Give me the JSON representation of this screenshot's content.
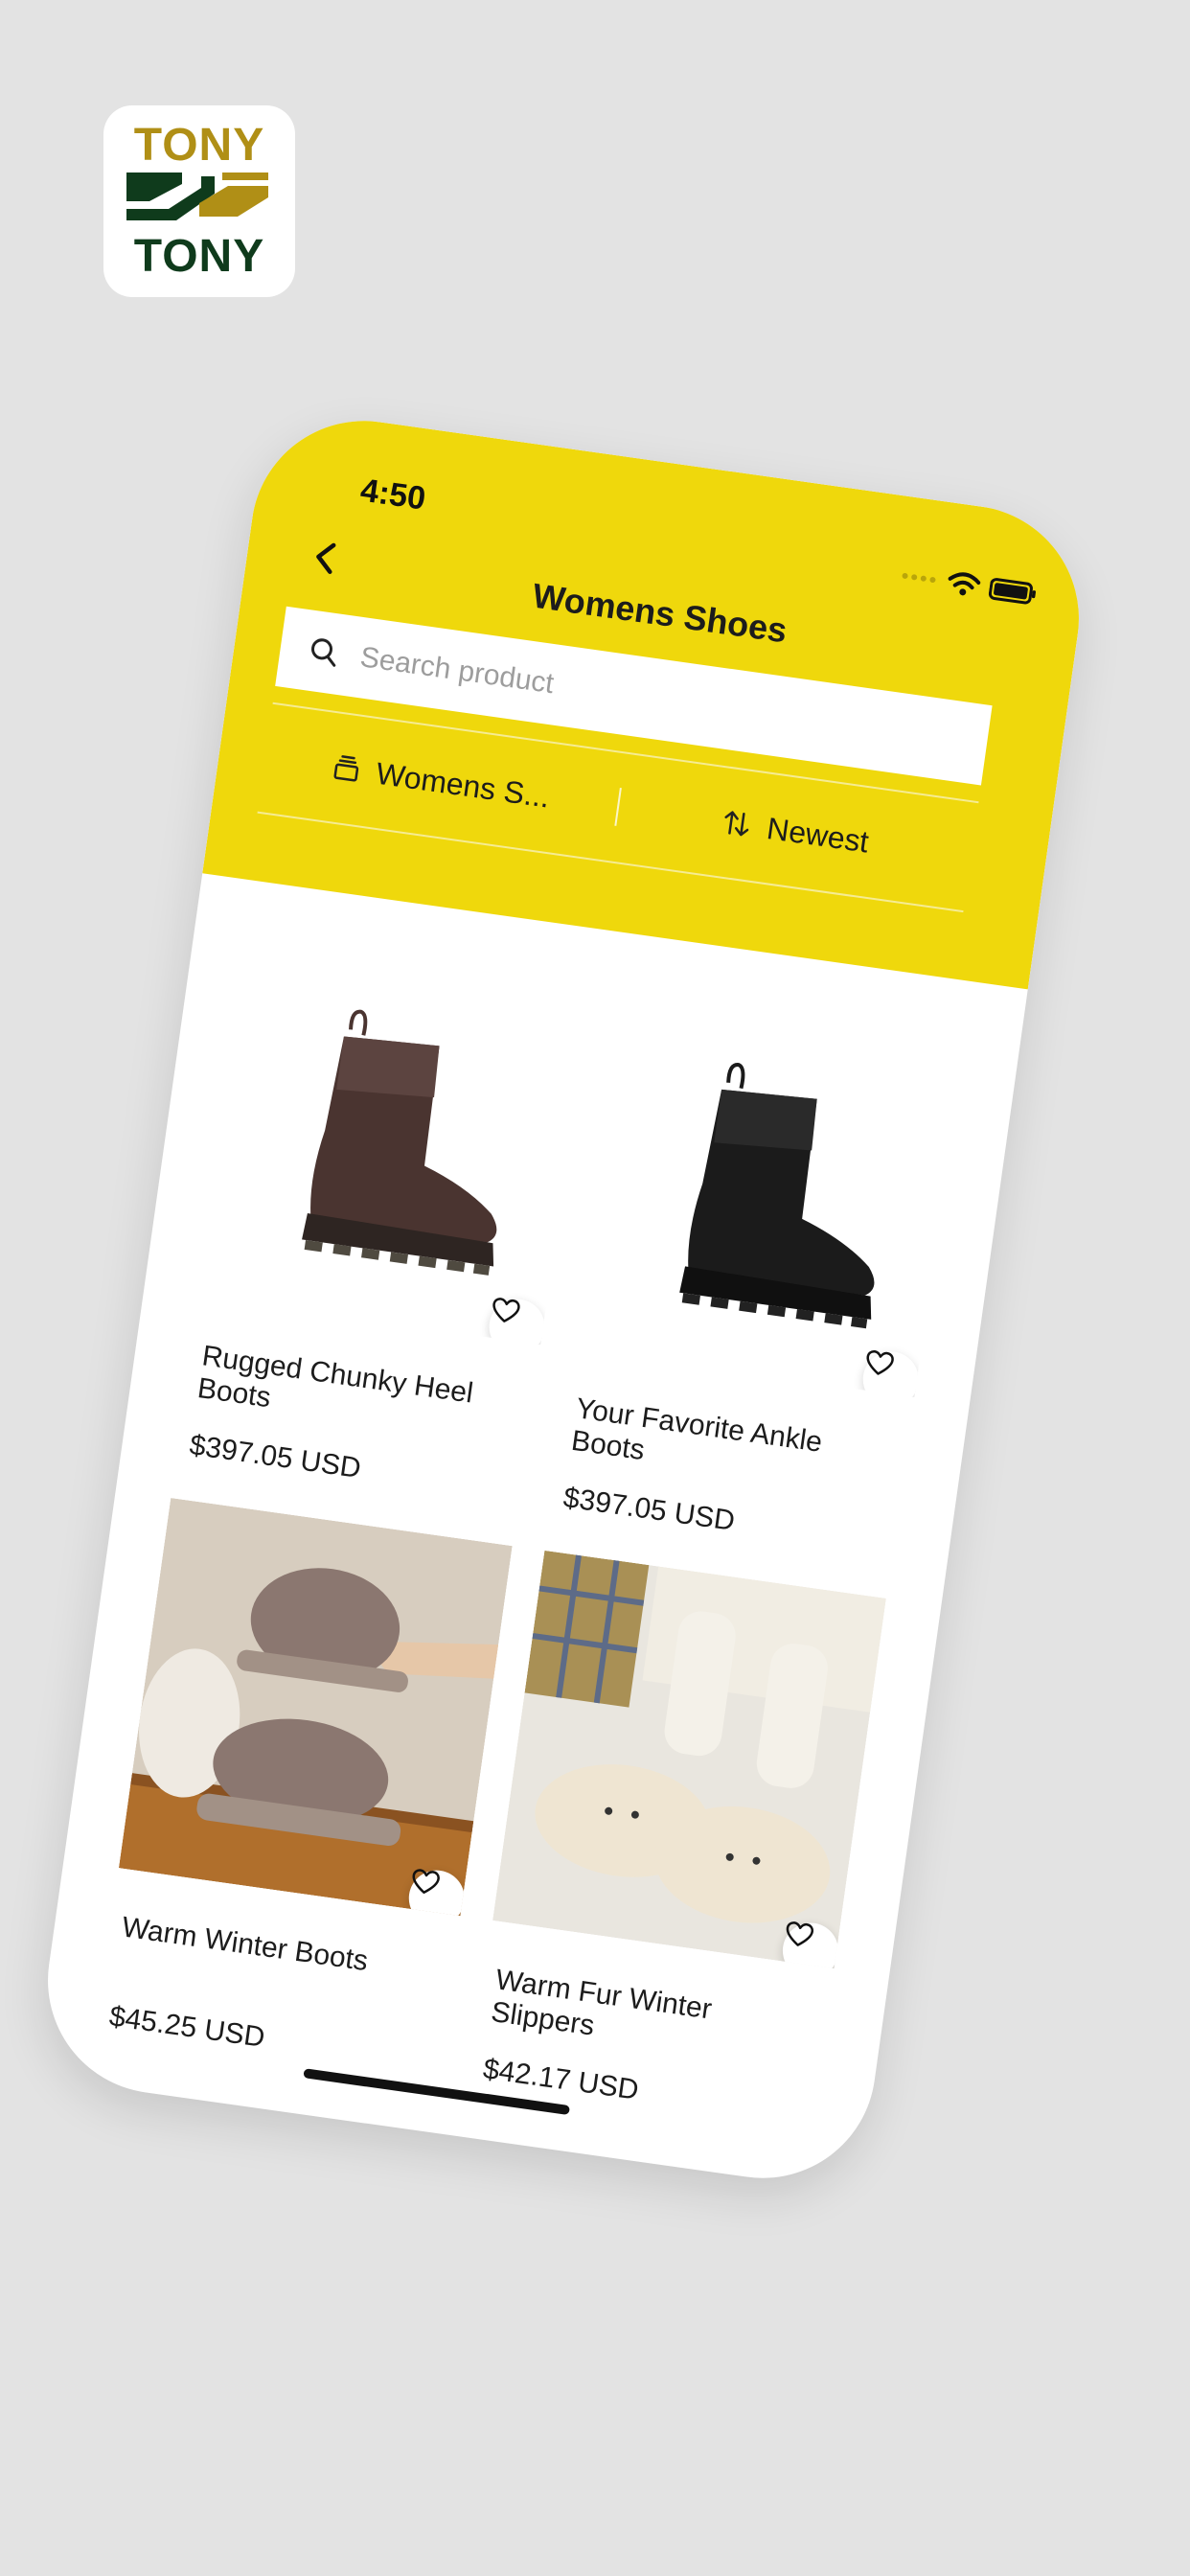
{
  "logo": {
    "line1": "TONY",
    "line2": "TONY"
  },
  "status_bar": {
    "time": "4:50"
  },
  "header": {
    "title": "Womens Shoes",
    "search_placeholder": "Search product",
    "category_filter": "Womens S...",
    "sort_filter": "Newest"
  },
  "products": [
    {
      "name": "Rugged Chunky Heel Boots",
      "price": "$397.05 USD",
      "image": "brown-chelsea-boot"
    },
    {
      "name": "Your Favorite Ankle Boots",
      "price": "$397.05 USD",
      "image": "black-chelsea-boot"
    },
    {
      "name": "Warm Winter Boots",
      "price": "$45.25 USD",
      "image": "fluffy-winter-boots-photo"
    },
    {
      "name": "Warm Fur Winter Slippers",
      "price": "$42.17 USD",
      "image": "sheep-slippers-photo"
    }
  ],
  "colors": {
    "accent": "#efd80c",
    "background": "#e3e3e3",
    "logo_gold": "#b08f16",
    "logo_green": "#0f3b1c"
  }
}
